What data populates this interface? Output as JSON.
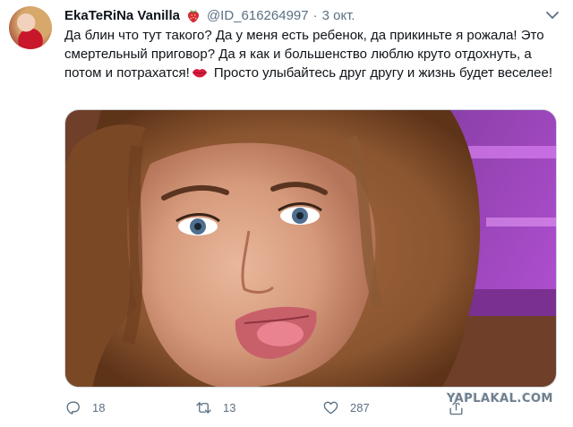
{
  "author": {
    "display_name": "EkaTeRiNa Vanilla",
    "name_emoji": "strawberry-emoji",
    "handle": "@ID_616264997",
    "separator": "·",
    "date": "3 окт."
  },
  "tweet": {
    "text_before_emoji": "Да блин что тут такого? Да у меня есть ребенок, да прикиньте я рожала! Это смертельный приговор? Да я как и большенство люблю круто отдохнуть, а потом и потрахатся!",
    "inline_emoji": "lips-emoji",
    "text_after_emoji": " Просто улыбайтесь друг другу и жизнь будет веселее!"
  },
  "media": {
    "type": "photo"
  },
  "actions": {
    "reply_count": "18",
    "retweet_count": "13",
    "like_count": "287"
  },
  "watermark": "YAPLAKAL.COM",
  "colors": {
    "text_primary": "#0f1419",
    "text_secondary": "#5b7083",
    "border": "#cfd9de"
  }
}
